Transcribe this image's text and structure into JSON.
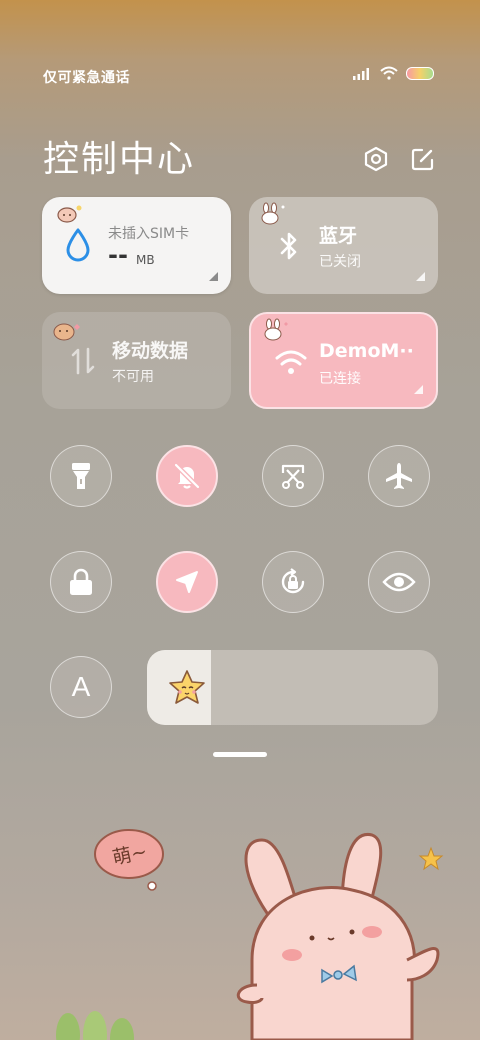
{
  "status_bar": {
    "carrier_text": "仅可紧急通话",
    "signal_icon": "signal-icon",
    "wifi_icon": "wifi-icon",
    "battery_icon": "battery-icon"
  },
  "header": {
    "title": "控制中心",
    "settings_icon": "settings-hexagon-icon",
    "edit_icon": "edit-icon"
  },
  "cards": {
    "data_usage": {
      "label": "未插入SIM卡",
      "value": "--",
      "unit": "MB",
      "icon": "water-drop-icon"
    },
    "bluetooth": {
      "title": "蓝牙",
      "status": "已关闭",
      "icon": "bluetooth-icon"
    },
    "mobile_data": {
      "title": "移动数据",
      "status": "不可用",
      "icon": "data-arrows-icon"
    },
    "wifi": {
      "title": "DemoM··",
      "status": "已连接",
      "icon": "wifi-icon"
    }
  },
  "toggles_row1": [
    {
      "name": "flashlight",
      "icon": "flashlight-icon",
      "active": false
    },
    {
      "name": "mute",
      "icon": "bell-mute-icon",
      "active": true
    },
    {
      "name": "screenshot",
      "icon": "scissors-screenshot-icon",
      "active": false
    },
    {
      "name": "airplane",
      "icon": "airplane-icon",
      "active": false
    }
  ],
  "toggles_row2": [
    {
      "name": "lock-screen",
      "icon": "lock-icon",
      "active": false
    },
    {
      "name": "location",
      "icon": "location-arrow-icon",
      "active": true
    },
    {
      "name": "auto-rotate",
      "icon": "rotate-lock-icon",
      "active": false
    },
    {
      "name": "reading-mode",
      "icon": "eye-icon",
      "active": false
    }
  ],
  "auto_brightness": {
    "label": "A",
    "icon": "auto-brightness-icon"
  },
  "brightness": {
    "level": 0.22,
    "icon": "star-face-icon"
  },
  "wallpaper": {
    "bubble_text": "萌~"
  },
  "colors": {
    "accent_pink": "#f7b9bf",
    "card_white": "#f5f4f3",
    "blue_drop": "#2c8fe6"
  }
}
